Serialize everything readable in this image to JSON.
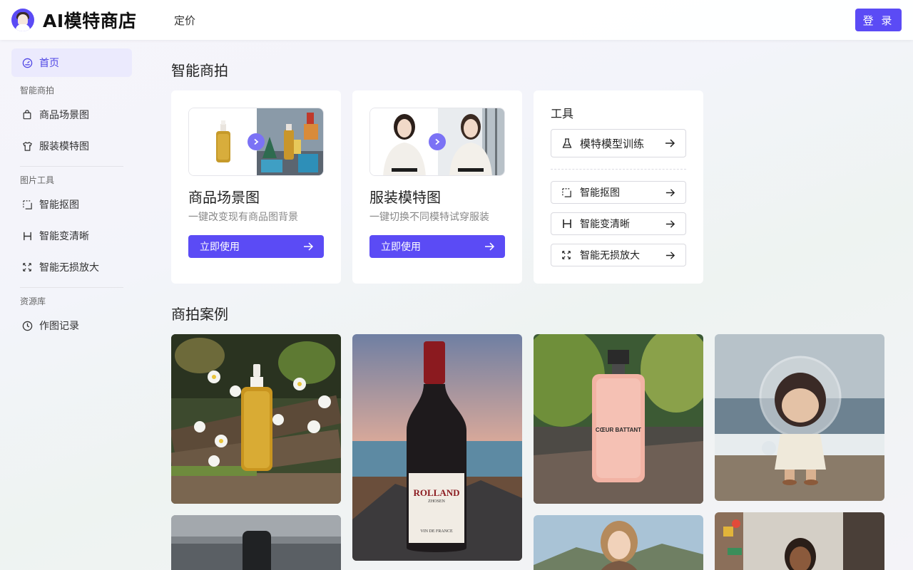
{
  "header": {
    "brand": "AI模特商店",
    "nav_pricing": "定价",
    "login": "登 录"
  },
  "sidebar": {
    "home": "首页",
    "group_shoot": "智能商拍",
    "item_scene": "商品场景图",
    "item_model": "服装模特图",
    "group_tools": "图片工具",
    "item_cutout": "智能抠图",
    "item_clear": "智能变清晰",
    "item_upscale": "智能无损放大",
    "group_library": "资源库",
    "item_history": "作图记录"
  },
  "main": {
    "section_shoot": "智能商拍",
    "card_scene": {
      "title": "商品场景图",
      "desc": "一键改变现有商品图背景",
      "button": "立即使用"
    },
    "card_model": {
      "title": "服装模特图",
      "desc": "一键切换不同模特试穿服装",
      "button": "立即使用"
    },
    "tools": {
      "title": "工具",
      "train": "模特模型训练",
      "cutout": "智能抠图",
      "clear": "智能变清晰",
      "upscale": "智能无损放大"
    },
    "section_cases": "商拍案例",
    "cases": {
      "wine_label": "ROLLAND",
      "wine_sub": "ZHOSEN",
      "wine_small": "VIN DE FRANCE",
      "perfume_label": "CŒUR BATTANT"
    }
  },
  "colors": {
    "accent": "#5b4bf5",
    "active_bg": "#ebeafd"
  }
}
